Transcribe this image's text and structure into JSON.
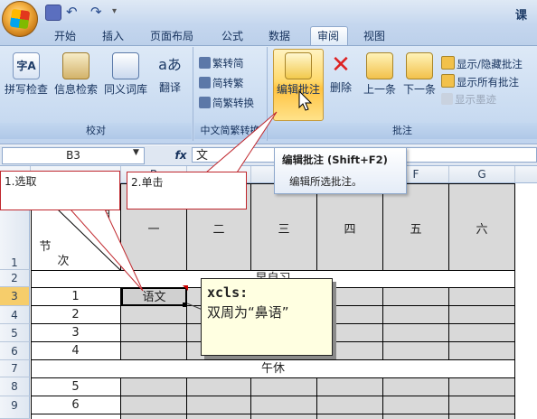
{
  "window": {
    "title": "课"
  },
  "quick_access": {
    "save_icon": "save-icon",
    "undo_icon": "undo-icon",
    "redo_icon": "redo-icon"
  },
  "tabs": [
    "开始",
    "插入",
    "页面布局",
    "公式",
    "数据",
    "审阅",
    "视图"
  ],
  "active_tab": "审阅",
  "ribbon": {
    "proofing": {
      "label": "校对",
      "buttons": [
        "拼写检查",
        "信息检索",
        "同义词库",
        "翻译"
      ]
    },
    "chinese_conversion": {
      "label": "中文简繁转换",
      "buttons": [
        "繁转简",
        "简转繁",
        "简繁转换"
      ]
    },
    "comments": {
      "label": "批注",
      "buttons": [
        "编辑批注",
        "删除",
        "上一条",
        "下一条"
      ],
      "small_buttons": [
        "显示/隐藏批注",
        "显示所有批注",
        "显示墨迹"
      ]
    }
  },
  "formula_bar": {
    "cell_ref": "B3",
    "fx": "fx",
    "content": "文"
  },
  "tooltip": {
    "title": "编辑批注 (Shift+F2)",
    "description": "编辑所选批注。"
  },
  "columns": [
    "B",
    "F",
    "G"
  ],
  "row_numbers": [
    "1",
    "2",
    "3",
    "4",
    "5",
    "6",
    "7",
    "8",
    "9"
  ],
  "sheet": {
    "header_corner": {
      "top": "星期",
      "bottom_1": "节",
      "bottom_2": "次"
    },
    "weekdays": [
      "一",
      "二",
      "三",
      "四",
      "五",
      "六"
    ],
    "morning_row": "早自习",
    "lessons": [
      "1",
      "2",
      "3",
      "4"
    ],
    "noon_row": "午休",
    "afternoon_lessons": [
      "5",
      "6"
    ],
    "b3_value": "语文"
  },
  "callouts": {
    "step1": "1.选取",
    "step2": "2.单击"
  },
  "comment": {
    "author": "xcls:",
    "text": "双周为“鼻语”"
  }
}
